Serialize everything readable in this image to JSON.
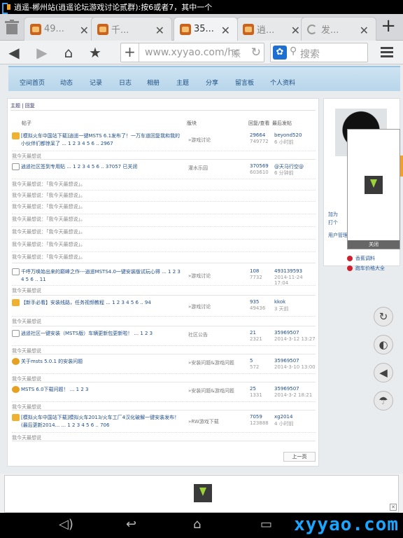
{
  "status_bar": {
    "title": "逍遥-郴州站(逍遥论坛游戏讨论贰群):按6或者7，其中一个"
  },
  "tabs": [
    {
      "label": "49..."
    },
    {
      "label": "千..."
    },
    {
      "label": "35..."
    },
    {
      "label": "逍..."
    },
    {
      "label": "发..."
    }
  ],
  "address_bar": {
    "url": "www.xyyao.com/hc",
    "qr_label": "賬"
  },
  "search": {
    "placeholder": "搜索"
  },
  "nav": [
    "空间首页",
    "动态",
    "记录",
    "日志",
    "相册",
    "主题",
    "分享",
    "留言板",
    "个人资料"
  ],
  "breadcrumb": "主题 | 回复",
  "headers": {
    "post": "帖子",
    "forum": "版块",
    "reply": "回复/查看",
    "last": "最后发帖"
  },
  "threads": [
    {
      "title": "[模拟火车中国站下载]逍遥一键MSTS 6.1发布了！一万车道回复我和我的小伙伴们都惊呆了 ... 1 2 3 4 5 6 .. 2967",
      "forum": "»游戏讨论",
      "replies": "29664",
      "views": "749772",
      "last_user": "beyond520",
      "last_time": "6 小时前"
    },
    {
      "title": "逍遥社区签到专用贴 ... 1 2 3 4 5 6 .. 37057 已关闭",
      "forum": "灌水乐园",
      "replies": "370569",
      "views": "603610",
      "last_user": "@天马行空@",
      "last_time": "6 分钟前"
    },
    {
      "title": "千呼万唤始出来的巅峰之作---逍遥MSTS4.0一键安装版试玩心得 ... 1 2 3 4 5 6 .. 11",
      "forum": "»游戏讨论",
      "replies": "108",
      "views": "7732",
      "last_user": "493139593",
      "last_time": "2014-11-24 17:04"
    },
    {
      "title": "【新手必看】安装线路，任务视频教程 ... 1 2 3 4 5 6 .. 94",
      "forum": "»游戏讨论",
      "replies": "935",
      "views": "49436",
      "last_user": "kkok",
      "last_time": "3 天前"
    },
    {
      "title": "逍遥社区一键安装（MSTS版）车辆更新包更新啦！ ... 1 2 3",
      "forum": "社区公告",
      "replies": "21",
      "views": "2321",
      "last_user": "35969507",
      "last_time": "2014-3-12 13:27"
    },
    {
      "title": "关于msts 5.0.1 的安装问题",
      "forum": "»安装问题&游戏问题",
      "replies": "5",
      "views": "572",
      "last_user": "35969507",
      "last_time": "2014-3-10 13:00"
    },
    {
      "title": "MSTS 6.0下载问题！ ... 1 2 3",
      "forum": "»安装问题&游戏问题",
      "replies": "25",
      "views": "1331",
      "last_user": "35969507",
      "last_time": "2014-3-2 18:21"
    },
    {
      "title": "[模拟火车中国站下载]模拟火车2013/火车工厂4汉化破解一键安装发布！(最后更新2014... ... 1 2 3 4 5 6 .. 706",
      "forum": "»RW游戏下载",
      "replies": "7059",
      "views": "123888",
      "last_user": "xg2014",
      "last_time": "4 小时前"
    }
  ],
  "quote_text": "我今天最想说：「我今天最想说」。",
  "quote_short": "我今天最想说",
  "pager": "上一页",
  "side": {
    "link1": "加为",
    "link2": "打个",
    "link3": "用户管理"
  },
  "popup_close": "关闭",
  "side_links": [
    "香蕉调料",
    "跑车价格大全"
  ],
  "watermark": "xyyao.com"
}
